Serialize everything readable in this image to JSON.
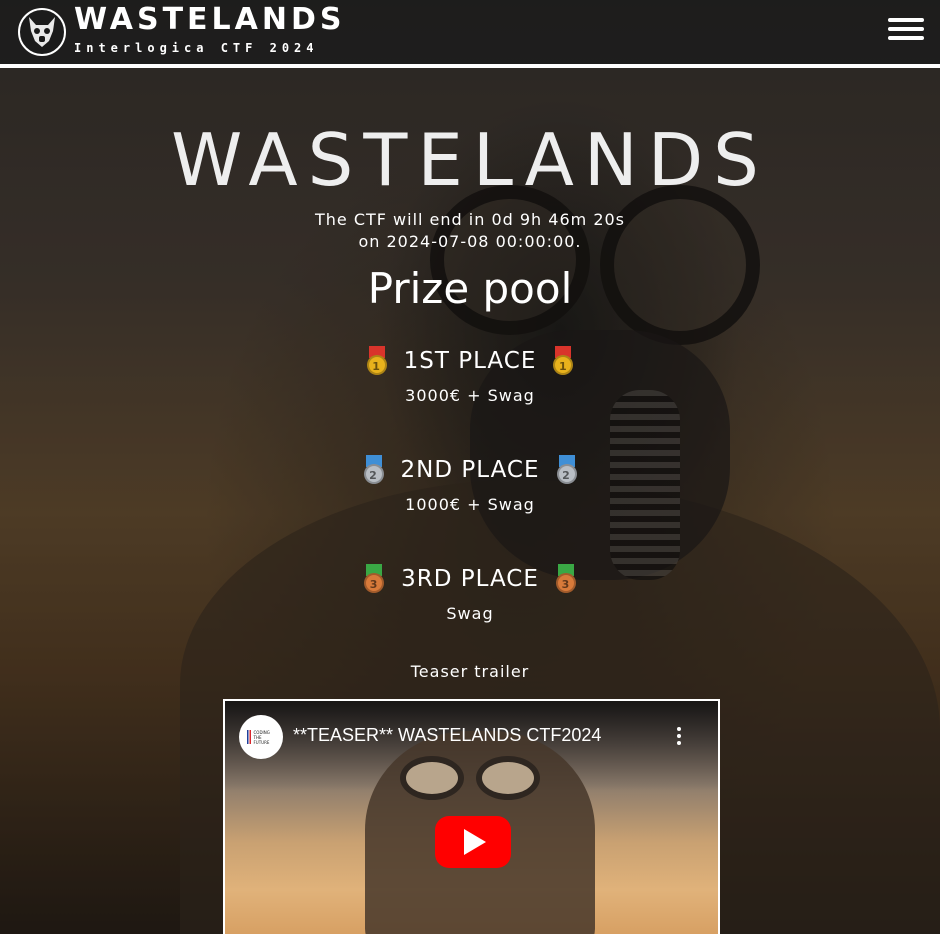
{
  "header": {
    "brand_title": "WASTELANDS",
    "brand_subtitle": "Interlogica CTF 2024",
    "menu_icon": "hamburger-menu-icon",
    "logo_icon": "wolf-mask-logo-icon"
  },
  "hero": {
    "title": "WASTELANDS",
    "countdown_line1": "The CTF will end in 0d 9h 46m 20s",
    "countdown_line2": "on 2024-07-08 00:00:00."
  },
  "prizes": {
    "heading": "Prize pool",
    "places": [
      {
        "title": "1ST PLACE",
        "prize": "3000€ + Swag",
        "medal_number": "1",
        "medal_color": "#e8b21c",
        "ribbon_color": "#d9342b"
      },
      {
        "title": "2ND PLACE",
        "prize": "1000€ + Swag",
        "medal_number": "2",
        "medal_color": "#b9bec4",
        "ribbon_color": "#3f8fd6"
      },
      {
        "title": "3RD PLACE",
        "prize": "Swag",
        "medal_number": "3",
        "medal_color": "#d87a3a",
        "ribbon_color": "#3aa845"
      }
    ]
  },
  "teaser": {
    "label": "Teaser trailer",
    "video_title": "**TEASER** WASTELANDS CTF2024",
    "channel_avatar_text": "CODING THE FUTURE",
    "play_icon": "youtube-play-icon",
    "more_icon": "more-vertical-icon"
  },
  "colors": {
    "text": "#ffffff",
    "play_button": "#ff0000"
  }
}
